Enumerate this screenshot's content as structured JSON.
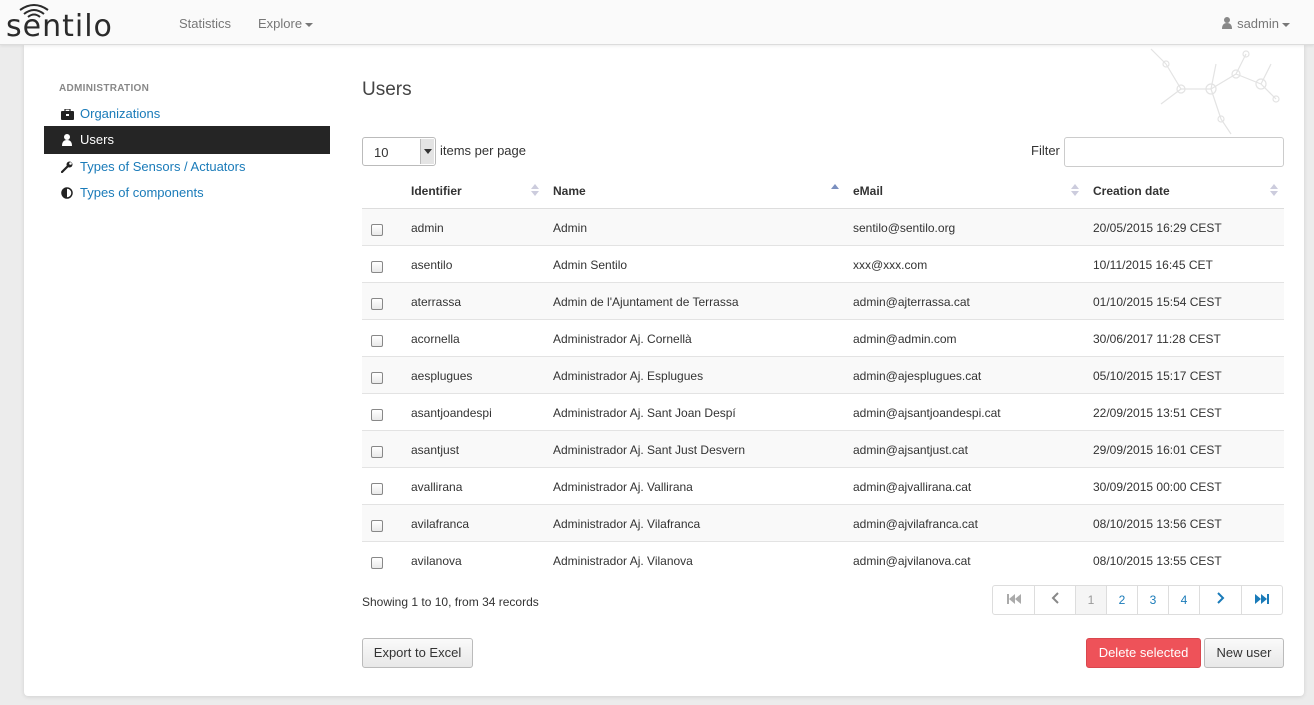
{
  "navbar": {
    "logo_text": "sentilo",
    "statistics": "Statistics",
    "explore": "Explore",
    "user": "sadmin"
  },
  "sidebar": {
    "header": "ADMINISTRATION",
    "items": [
      {
        "label": "Organizations",
        "icon": "briefcase-icon",
        "active": false
      },
      {
        "label": "Users",
        "icon": "user-icon",
        "active": true
      },
      {
        "label": "Types of Sensors / Actuators",
        "icon": "wrench-icon",
        "active": false
      },
      {
        "label": "Types of components",
        "icon": "half-circle-icon",
        "active": false
      }
    ]
  },
  "main": {
    "title": "Users",
    "items_per_page_value": "10",
    "items_per_page_label": "items per page",
    "filter_label": "Filter",
    "filter_value": ""
  },
  "table": {
    "columns": [
      "Identifier",
      "Name",
      "eMail",
      "Creation date"
    ],
    "sorted_column": "Name",
    "rows": [
      {
        "id": "admin",
        "name": "Admin",
        "email": "sentilo@sentilo.org",
        "created": "20/05/2015 16:29 CEST"
      },
      {
        "id": "asentilo",
        "name": "Admin Sentilo",
        "email": "xxx@xxx.com",
        "created": "10/11/2015 16:45 CET"
      },
      {
        "id": "aterrassa",
        "name": "Admin de l'Ajuntament de Terrassa",
        "email": "admin@ajterrassa.cat",
        "created": "01/10/2015 15:54 CEST"
      },
      {
        "id": "acornella",
        "name": "Administrador Aj. Cornellà",
        "email": "admin@admin.com",
        "created": "30/06/2017 11:28 CEST"
      },
      {
        "id": "aesplugues",
        "name": "Administrador Aj. Esplugues",
        "email": "admin@ajesplugues.cat",
        "created": "05/10/2015 15:17 CEST"
      },
      {
        "id": "asantjoandespi",
        "name": "Administrador Aj. Sant Joan Despí",
        "email": "admin@ajsantjoandespi.cat",
        "created": "22/09/2015 13:51 CEST"
      },
      {
        "id": "asantjust",
        "name": "Administrador Aj. Sant Just Desvern",
        "email": "admin@ajsantjust.cat",
        "created": "29/09/2015 16:01 CEST"
      },
      {
        "id": "avallirana",
        "name": "Administrador Aj. Vallirana",
        "email": "admin@ajvallirana.cat",
        "created": "30/09/2015 00:00 CEST"
      },
      {
        "id": "avilafranca",
        "name": "Administrador Aj. Vilafranca",
        "email": "admin@ajvilafranca.cat",
        "created": "08/10/2015 13:56 CEST"
      },
      {
        "id": "avilanova",
        "name": "Administrador Aj. Vilanova",
        "email": "admin@ajvilanova.cat",
        "created": "08/10/2015 13:55 CEST"
      }
    ]
  },
  "footer": {
    "showing": "Showing 1 to 10, from 34 records",
    "pages": [
      "1",
      "2",
      "3",
      "4"
    ],
    "current_page": "1",
    "export_label": "Export to Excel",
    "delete_label": "Delete selected",
    "new_label": "New user"
  },
  "colors": {
    "link": "#1a7bb9",
    "active_sidebar": "#252525",
    "danger": "#ee5259"
  }
}
